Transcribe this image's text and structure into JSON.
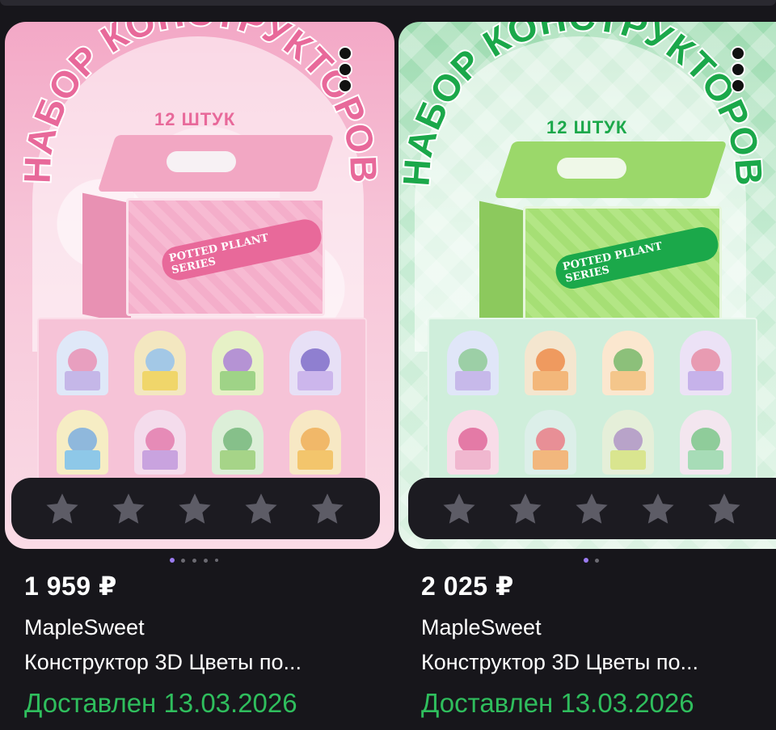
{
  "products": [
    {
      "image_title": "НАБОР КОНСТРУКТОРОВ",
      "image_count": "12 ШТУК",
      "box_text": "POTTED PLLANT SERIES",
      "price": "1 959 ₽",
      "brand": "MapleSweet",
      "name": "Конструктор 3D Цветы по...",
      "status": "Доставлен 13.03.2026",
      "rating_stars": 5,
      "image_pages": 5,
      "active_image_page": 1,
      "theme_color": "#e8699a"
    },
    {
      "image_title": "НАБОР КОНСТРУКТОРОВ",
      "image_count": "12 ШТУК",
      "box_text": "POTTED PLLANT SERIES",
      "price": "2 025 ₽",
      "brand": "MapleSweet",
      "name": "Конструктор 3D Цветы по...",
      "status": "Доставлен 13.03.2026",
      "rating_stars": 5,
      "image_pages": 2,
      "active_image_page": 1,
      "theme_color": "#1ba84a"
    }
  ],
  "colors": {
    "background": "#17161b",
    "delivered": "#2fbe5d",
    "star_empty": "#5d5c66",
    "dot_active": "#9b7bf0",
    "dot_inactive": "#6b6a72"
  },
  "icons": {
    "menu": "more-vertical-icon",
    "star": "star-icon"
  }
}
